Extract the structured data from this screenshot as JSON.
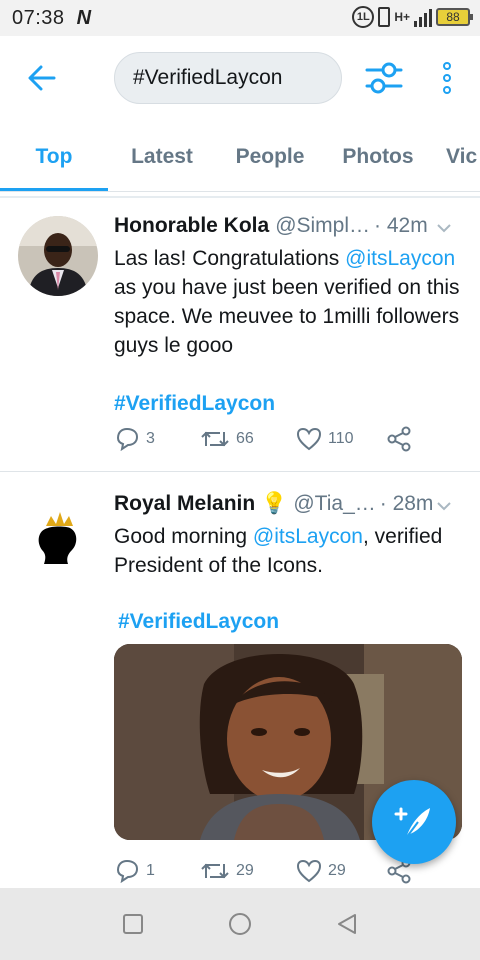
{
  "status_bar": {
    "time": "07:38",
    "carrier_glyph": "N",
    "sim_label": "1L",
    "network_label": "H+",
    "battery": "88"
  },
  "header": {
    "back_icon": "arrow-left-icon",
    "search_value": "#VerifiedLaycon",
    "filter_icon": "filter-sliders-icon",
    "more_icon": "more-vertical-icon"
  },
  "tabs": [
    {
      "label": "Top",
      "active": true
    },
    {
      "label": "Latest",
      "active": false
    },
    {
      "label": "People",
      "active": false
    },
    {
      "label": "Photos",
      "active": false
    },
    {
      "label": "Vic",
      "active": false
    }
  ],
  "tweets": [
    {
      "name": "Honorable Kola",
      "handle": "@Simpl…",
      "time": "· 42m",
      "text_before": "Las las! Congratulations ",
      "mention": "@itsLaycon",
      "text_after": " as you have just been verified on this space. We meuvee to 1milli followers guys le gooo",
      "hashtag": "#VerifiedLaycon",
      "replies": "3",
      "retweets": "66",
      "likes": "110"
    },
    {
      "name": "Royal Melanin",
      "name_emoji": "💡",
      "handle": "@Tia_…",
      "time": "· 28m",
      "text_before": "Good morning ",
      "mention": "@itsLaycon",
      "text_after": ", verified President of the Icons.",
      "hashtag": "#VerifiedLaycon",
      "replies": "1",
      "retweets": "29",
      "likes": "29"
    }
  ],
  "colors": {
    "accent": "#1da1f2",
    "text": "#14171a",
    "muted": "#657786"
  }
}
